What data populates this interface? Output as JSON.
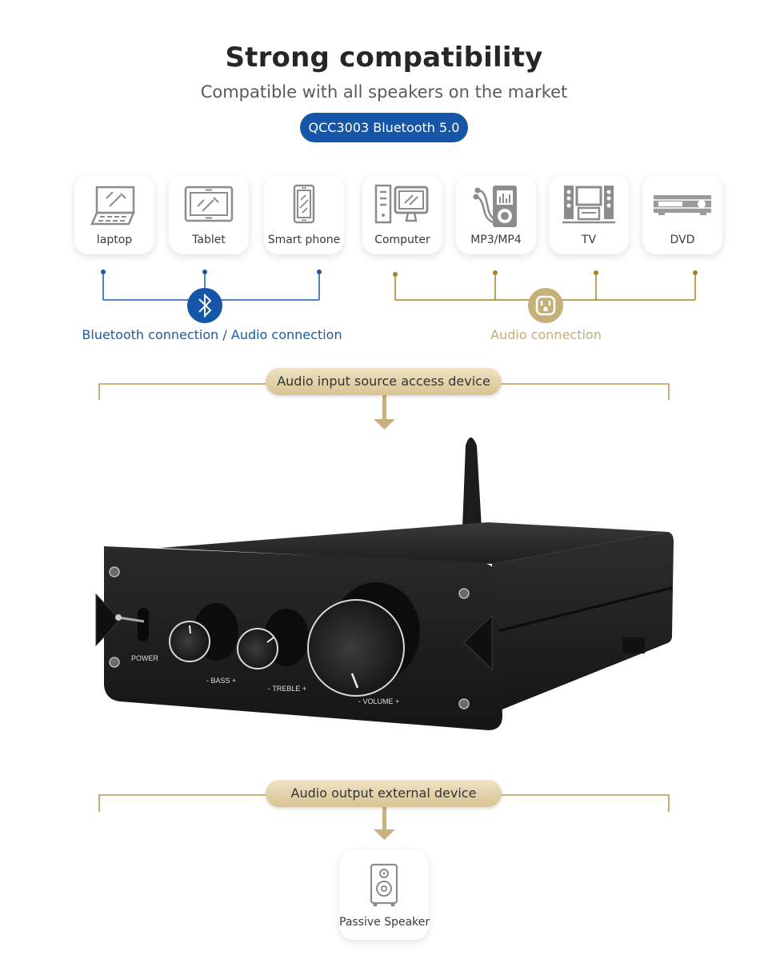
{
  "header": {
    "title": "Strong compatibility",
    "subtitle": "Compatible with all speakers on the market",
    "badge": "QCC3003 Bluetooth 5.0"
  },
  "colors": {
    "blue": "#1656a8",
    "gold": "#a78429",
    "gold_light": "#c2ac7c",
    "pill_gold": "#e3d3ab"
  },
  "source_devices": [
    {
      "label": "laptop",
      "icon": "laptop-icon"
    },
    {
      "label": "Tablet",
      "icon": "tablet-icon"
    },
    {
      "label": "Smart phone",
      "icon": "smartphone-icon"
    },
    {
      "label": "Computer",
      "icon": "computer-icon"
    },
    {
      "label": "MP3/MP4",
      "icon": "mp3-player-icon"
    },
    {
      "label": "TV",
      "icon": "tv-icon"
    },
    {
      "label": "DVD",
      "icon": "dvd-player-icon"
    }
  ],
  "connections": {
    "bluetooth_label": "Bluetooth connection / Audio connection",
    "bluetooth_icon": "bluetooth-icon",
    "audio_label": "Audio connection",
    "audio_icon": "power-outlet-icon"
  },
  "input_section": {
    "label": "Audio input source access device"
  },
  "amplifier": {
    "power_label": "POWER",
    "bass_label": "- BASS +",
    "treble_label": "- TREBLE +",
    "volume_label": "- VOLUME +"
  },
  "output_section": {
    "label": "Audio output external device"
  },
  "output_device": {
    "label": "Passive Speaker",
    "icon": "speaker-icon"
  }
}
